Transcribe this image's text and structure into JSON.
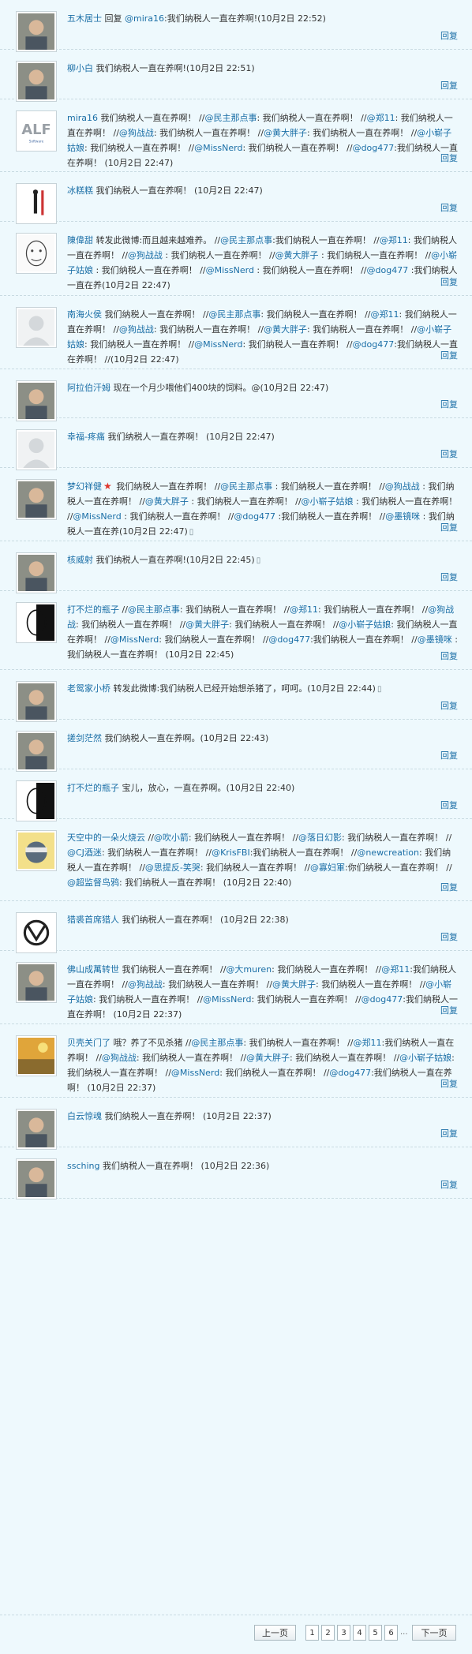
{
  "reply_label": "回复",
  "comments": [
    {
      "avatar": "photo-avatar",
      "author": "五木居士",
      "parts": [
        {
          "t": " 回复 "
        },
        {
          "m": "@mira16"
        },
        {
          "t": ":我们纳税人一直在养啊!(10月2日 22:52)"
        }
      ],
      "h": 63
    },
    {
      "avatar": "photo-avatar",
      "author": "柳小白",
      "parts": [
        {
          "t": " 我们纳税人一直在养啊!(10月2日 22:51)"
        }
      ],
      "h": 63
    },
    {
      "avatar": "alf-logo-avatar",
      "author": "mira16",
      "parts": [
        {
          "t": " 我们纳税人一直在养啊！ //"
        },
        {
          "m": "@民主那点事"
        },
        {
          "t": ": 我们纳税人一直在养啊！ //"
        },
        {
          "m": "@郑11"
        },
        {
          "t": ": 我们纳税人一直在养啊！ //"
        },
        {
          "m": "@狗战战"
        },
        {
          "t": ": 我们纳税人一直在养啊！ //"
        },
        {
          "m": "@黄大胖子"
        },
        {
          "t": ": 我们纳税人一直在养啊！ //"
        },
        {
          "m": "@小崭子姑娘"
        },
        {
          "t": ": 我们纳税人一直在养啊！ //"
        },
        {
          "m": "@MissNerd"
        },
        {
          "t": ": 我们纳税人一直在养啊！ //"
        },
        {
          "m": "@dog477"
        },
        {
          "t": ":我们纳税人一直在养啊！ (10月2日 22:47)"
        }
      ],
      "h": 92
    },
    {
      "avatar": "figure-avatar",
      "author": "冰糕糕",
      "parts": [
        {
          "t": " 我们纳税人一直在养啊！ (10月2日 22:47)"
        }
      ],
      "h": 63
    },
    {
      "avatar": "sketch-face-avatar",
      "author": "陳偉甜",
      "parts": [
        {
          "t": " 转发此微博:而且越来越难养。 //"
        },
        {
          "m": "@民主那点事"
        },
        {
          "t": ":我们纳税人一直在养啊！ //"
        },
        {
          "m": "@郑11"
        },
        {
          "t": ": 我们纳税人一直在养啊！ //"
        },
        {
          "m": "@狗战战"
        },
        {
          "t": " : 我们纳税人一直在养啊！ //"
        },
        {
          "m": "@黄大胖子"
        },
        {
          "t": " : 我们纳税人一直在养啊！ //"
        },
        {
          "m": "@小崭子姑娘"
        },
        {
          "t": " : 我们纳税人一直在养啊！ //"
        },
        {
          "m": "@MissNerd"
        },
        {
          "t": " : 我们纳税人一直在养啊！ //"
        },
        {
          "m": "@dog477"
        },
        {
          "t": " :我们纳税人一直在养(10月2日 22:47)"
        }
      ],
      "h": 94
    },
    {
      "avatar": "default-avatar",
      "author": "南海火侯",
      "parts": [
        {
          "t": " 我们纳税人一直在养啊！ //"
        },
        {
          "m": "@民主那点事"
        },
        {
          "t": ": 我们纳税人一直在养啊！ //"
        },
        {
          "m": "@郑11"
        },
        {
          "t": ": 我们纳税人一直在养啊！ //"
        },
        {
          "m": "@狗战战"
        },
        {
          "t": ": 我们纳税人一直在养啊！ //"
        },
        {
          "m": "@黄大胖子"
        },
        {
          "t": ": 我们纳税人一直在养啊！ //"
        },
        {
          "m": "@小崭子姑娘"
        },
        {
          "t": ": 我们纳税人一直在养啊！ //"
        },
        {
          "m": "@MissNerd"
        },
        {
          "t": ": 我们纳税人一直在养啊！ //"
        },
        {
          "m": "@dog477"
        },
        {
          "t": ":我们纳税人一直在养啊！ //(10月2日 22:47)"
        }
      ],
      "h": 93
    },
    {
      "avatar": "photo-avatar",
      "author": "阿拉伯汗姆",
      "parts": [
        {
          "t": " 现在一个月少喂他们400块的饲料。@(10月2日 22:47)"
        }
      ],
      "h": 62
    },
    {
      "avatar": "default-avatar",
      "author": "幸福-疼痛",
      "parts": [
        {
          "t": " 我们纳税人一直在养啊！ (10月2日 22:47)"
        }
      ],
      "h": 63
    },
    {
      "avatar": "photo-avatar",
      "author": "梦幻祥健",
      "star": true,
      "parts": [
        {
          "t": " 我们纳税人一直在养啊！ //"
        },
        {
          "m": "@民主那点事"
        },
        {
          "t": " : 我们纳税人一直在养啊！ //"
        },
        {
          "m": "@狗战战"
        },
        {
          "t": " : 我们纳税人一直在养啊！ //"
        },
        {
          "m": "@黄大胖子"
        },
        {
          "t": " : 我们纳税人一直在养啊！ //"
        },
        {
          "m": "@小崭子姑娘"
        },
        {
          "t": " : 我们纳税人一直在养啊！ //"
        },
        {
          "m": "@MissNerd"
        },
        {
          "t": " : 我们纳税人一直在养啊！ //"
        },
        {
          "m": "@dog477"
        },
        {
          "t": " :我们纳税人一直在养啊！ //"
        },
        {
          "m": "@墨镜咪"
        },
        {
          "t": " : 我们纳税人一直在养(10月2日 22:47)"
        }
      ],
      "clip": true,
      "h": 93
    },
    {
      "avatar": "photo-avatar",
      "author": "核威射",
      "parts": [
        {
          "t": " 我们纳税人一直在养啊!(10月2日 22:45)"
        }
      ],
      "clip": true,
      "h": 63
    },
    {
      "avatar": "half-face-avatar",
      "author": "打不烂的瓶子",
      "parts": [
        {
          "t": " //"
        },
        {
          "m": "@民主那点事"
        },
        {
          "t": ": 我们纳税人一直在养啊！ //"
        },
        {
          "m": "@郑11"
        },
        {
          "t": ": 我们纳税人一直在养啊！ //"
        },
        {
          "m": "@狗战战"
        },
        {
          "t": ": 我们纳税人一直在养啊！ //"
        },
        {
          "m": "@黄大胖子"
        },
        {
          "t": ": 我们纳税人一直在养啊！ //"
        },
        {
          "m": "@小崭子姑娘"
        },
        {
          "t": ": 我们纳税人一直在养啊！ //"
        },
        {
          "m": "@MissNerd"
        },
        {
          "t": ": 我们纳税人一直在养啊！ //"
        },
        {
          "m": "@dog477"
        },
        {
          "t": ":我们纳税人一直在养啊！ //"
        },
        {
          "m": "@墨镜咪"
        },
        {
          "t": " : 我们纳税人一直在养啊！ (10月2日 22:45)"
        }
      ],
      "h": 100
    },
    {
      "avatar": "photo-avatar",
      "author": "老鸳家小桥",
      "parts": [
        {
          "t": " 转发此微博:我们纳税人已经开始想杀猪了，呵呵。(10月2日 22:44)"
        }
      ],
      "clip": true,
      "h": 63
    },
    {
      "avatar": "photo-avatar",
      "author": "搓剑茫然",
      "parts": [
        {
          "t": " 我们纳税人一直在养啊。(10月2日 22:43)"
        }
      ],
      "h": 63
    },
    {
      "avatar": "half-face-avatar",
      "author": "打不烂的瓶子",
      "parts": [
        {
          "t": " 宝儿，放心，一直在养啊。(10月2日 22:40)"
        }
      ],
      "h": 63
    },
    {
      "avatar": "cartoon-avatar",
      "author": "天空中的一朵火烧云",
      "parts": [
        {
          "t": " //"
        },
        {
          "m": "@吹小箭"
        },
        {
          "t": ": 我们纳税人一直在养啊！ //"
        },
        {
          "m": "@落日幻影"
        },
        {
          "t": ": 我们纳税人一直在养啊！ //"
        },
        {
          "m": "@CJ酒迷"
        },
        {
          "t": ": 我们纳税人一直在养啊！ //"
        },
        {
          "m": "@KrisFBI"
        },
        {
          "t": ":我们纳税人一直在养啊！ //"
        },
        {
          "m": "@newcreation"
        },
        {
          "t": ": 我们纳税人一直在养啊！ //"
        },
        {
          "m": "@思提反-笑哭"
        },
        {
          "t": ": 我们纳税人一直在养啊！ //"
        },
        {
          "m": "@寡妇軍"
        },
        {
          "t": ":你们纳税人一直在养啊！ //"
        },
        {
          "m": "@超监督鸟鸦"
        },
        {
          "t": ": 我们纳税人一直在养啊！ (10月2日 22:40)"
        }
      ],
      "h": 104
    },
    {
      "avatar": "emblem-avatar",
      "author": "猎裘首席猎人",
      "parts": [
        {
          "t": " 我们纳税人一直在养啊！ (10月2日 22:38)"
        }
      ],
      "h": 63
    },
    {
      "avatar": "photo-avatar",
      "author": "佛山成萬转世",
      "parts": [
        {
          "t": " 我们纳税人一直在养啊！ //"
        },
        {
          "m": "@大muren"
        },
        {
          "t": ": 我们纳税人一直在养啊！ //"
        },
        {
          "m": "@郑11"
        },
        {
          "t": ":我们纳税人一直在养啊！ //"
        },
        {
          "m": "@狗战战"
        },
        {
          "t": ": 我们纳税人一直在养啊！ //"
        },
        {
          "m": "@黄大胖子"
        },
        {
          "t": ": 我们纳税人一直在养啊！ //"
        },
        {
          "m": "@小崭子姑娘"
        },
        {
          "t": ": 我们纳税人一直在养啊！ //"
        },
        {
          "m": "@MissNerd"
        },
        {
          "t": ": 我们纳税人一直在养啊！ //"
        },
        {
          "m": "@dog477"
        },
        {
          "t": ":我们纳税人一直在养啊！ (10月2日 22:37)"
        }
      ],
      "h": 93
    },
    {
      "avatar": "painting-avatar",
      "author": "贝壳关门了",
      "parts": [
        {
          "t": " 哦？养了不见杀猪 //"
        },
        {
          "m": "@民主那点事"
        },
        {
          "t": ": 我们纳税人一直在养啊！ //"
        },
        {
          "m": "@郑11"
        },
        {
          "t": ":我们纳税人一直在养啊！ //"
        },
        {
          "m": "@狗战战"
        },
        {
          "t": ": 我们纳税人一直在养啊！ //"
        },
        {
          "m": "@黄大胖子"
        },
        {
          "t": ": 我们纳税人一直在养啊！ //"
        },
        {
          "m": "@小崭子姑娘"
        },
        {
          "t": ": 我们纳税人一直在养啊！ //"
        },
        {
          "m": "@MissNerd"
        },
        {
          "t": ": 我们纳税人一直在养啊！ //"
        },
        {
          "m": "@dog477"
        },
        {
          "t": ":我们纳税人一直在养啊！ (10月2日 22:37)"
        }
      ],
      "h": 93
    },
    {
      "avatar": "photo-avatar",
      "author": "白云惊魂",
      "parts": [
        {
          "t": " 我们纳税人一直在养啊！ (10月2日 22:37)"
        }
      ],
      "h": 63
    },
    {
      "avatar": "photo-avatar",
      "author": "ssching",
      "parts": [
        {
          "t": " 我们纳税人一直在养啊！ (10月2日 22:36)"
        }
      ],
      "h": 65
    }
  ],
  "pager": {
    "prev_label": "上一页",
    "pages": [
      "1",
      "2",
      "3",
      "4",
      "5",
      "6"
    ],
    "current": "1",
    "ellipsis": "...",
    "next_label": "下一页"
  }
}
